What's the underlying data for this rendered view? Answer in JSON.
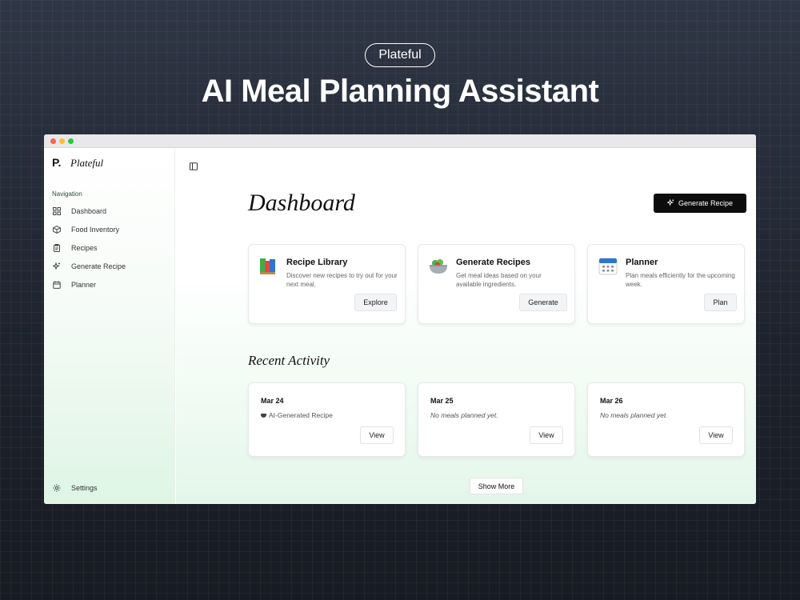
{
  "hero": {
    "brand_pill": "Plateful",
    "title": "AI Meal Planning Assistant"
  },
  "sidebar": {
    "brand_mark": "P.",
    "brand_name": "Plateful",
    "nav_heading": "Navigation",
    "items": [
      {
        "label": "Dashboard",
        "icon": "grid-icon"
      },
      {
        "label": "Food Inventory",
        "icon": "box-icon"
      },
      {
        "label": "Recipes",
        "icon": "clipboard-icon"
      },
      {
        "label": "Generate Recipe",
        "icon": "sparkle-icon"
      },
      {
        "label": "Planner",
        "icon": "calendar-icon"
      }
    ],
    "settings_label": "Settings"
  },
  "main": {
    "page_title": "Dashboard",
    "generate_button": "Generate Recipe",
    "feature_cards": [
      {
        "title": "Recipe Library",
        "description": "Discover new recipes to try out for your next meal.",
        "button": "Explore",
        "icon": "books-icon"
      },
      {
        "title": "Generate Recipes",
        "description": "Get meal ideas based on your available ingredients.",
        "button": "Generate",
        "icon": "salad-bowl-icon"
      },
      {
        "title": "Planner",
        "description": "Plan meals efficiently for the upcoming week.",
        "button": "Plan",
        "icon": "calendar-icon"
      }
    ],
    "recent_activity_title": "Recent Activity",
    "activity": [
      {
        "date": "Mar 24",
        "note": "AI-Generated Recipe",
        "button": "View"
      },
      {
        "date": "Mar 25",
        "note": "No meals planned yet.",
        "button": "View"
      },
      {
        "date": "Mar 26",
        "note": "No meals planned yet.",
        "button": "View"
      }
    ],
    "show_more": "Show More"
  },
  "colors": {
    "accent_dark": "#0c0c0c",
    "sidebar_gradient_end": "#def5e4",
    "nav_heading": "#2b4f34"
  }
}
